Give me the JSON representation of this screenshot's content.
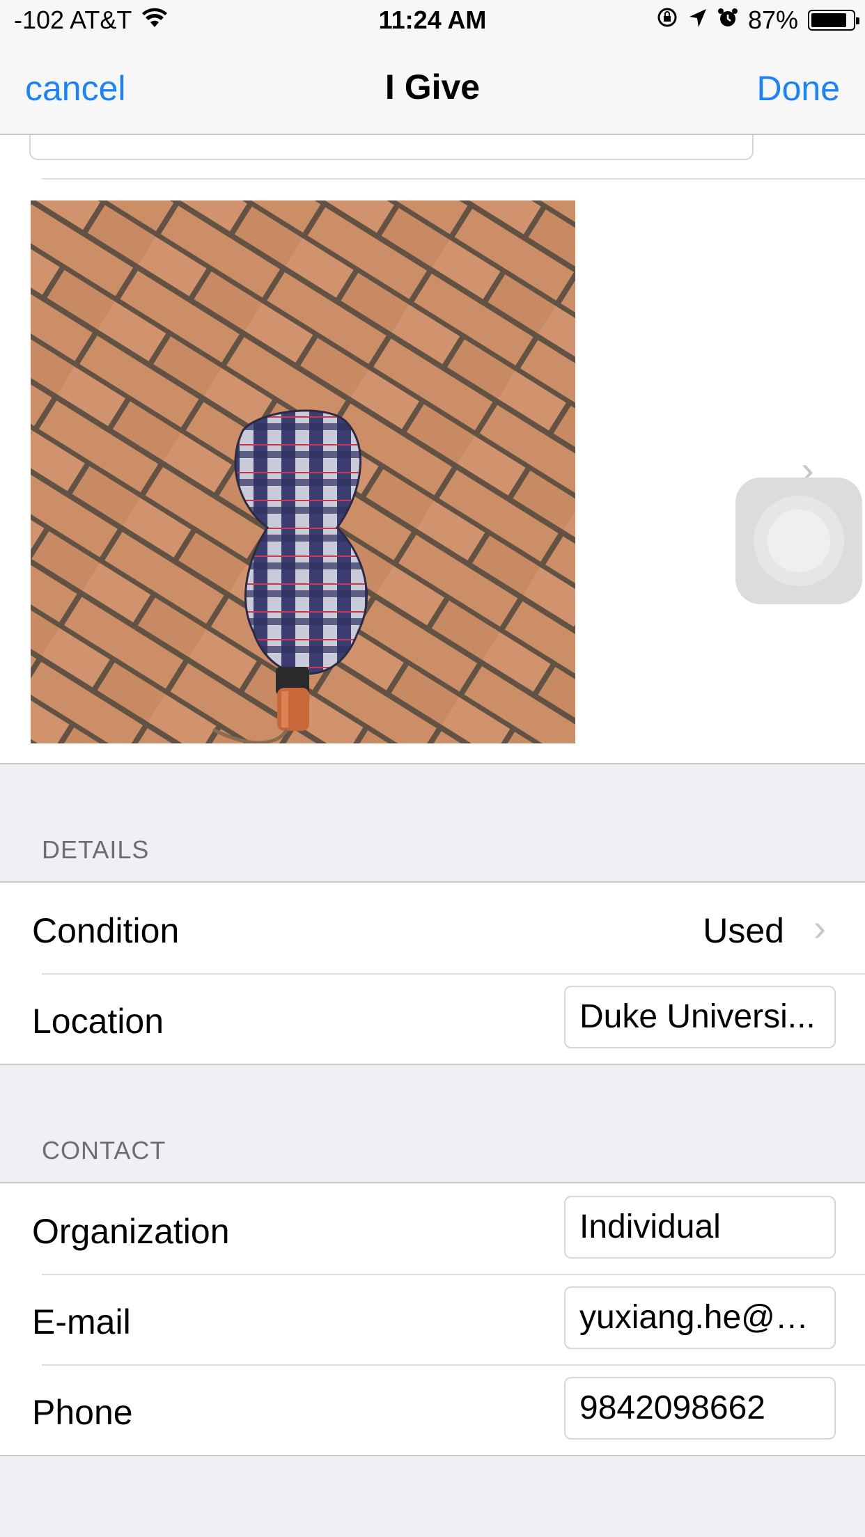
{
  "status_bar": {
    "carrier": "-102 AT&T",
    "time": "11:24 AM",
    "battery_percent": "87%",
    "battery_level": 0.87,
    "icons": [
      "wifi-icon",
      "orientation-lock-icon",
      "location-arrow-icon",
      "alarm-icon",
      "battery-icon"
    ]
  },
  "nav": {
    "cancel_label": "cancel",
    "title": "I Give",
    "done_label": "Done"
  },
  "photo": {
    "description_icon": "chevron-right-icon"
  },
  "details": {
    "header": "DETAILS",
    "condition_label": "Condition",
    "condition_value": "Used",
    "location_label": "Location",
    "location_value": "Duke Universi..."
  },
  "contact": {
    "header": "CONTACT",
    "organization_label": "Organization",
    "organization_value": "Individual",
    "email_label": "E-mail",
    "email_value": "yuxiang.he@d...",
    "phone_label": "Phone",
    "phone_value": "9842098662"
  },
  "colors": {
    "accent": "#1a82fb",
    "background": "#efeff4",
    "separator": "#c8c7cc",
    "section_header": "#6d6d72"
  }
}
